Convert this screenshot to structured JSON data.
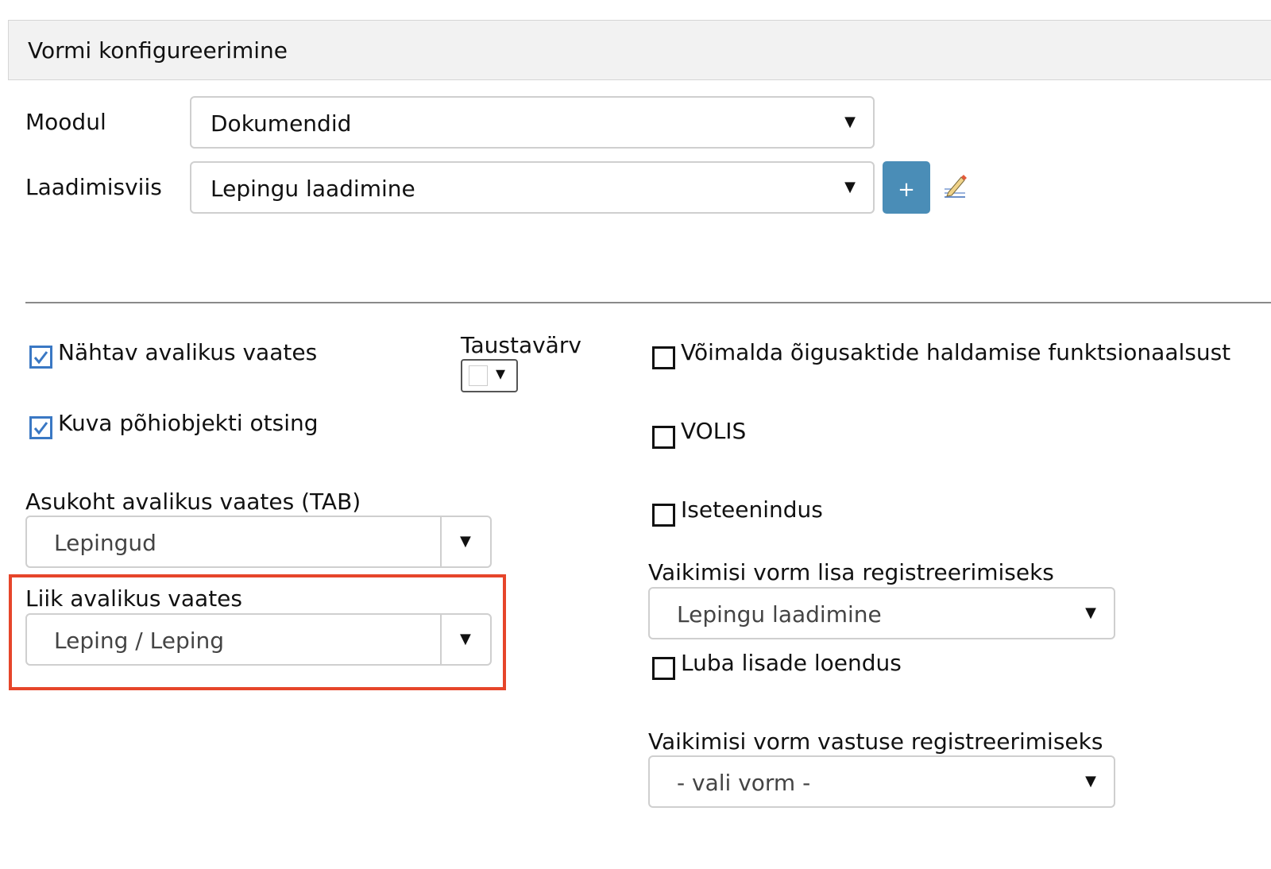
{
  "header": {
    "title": "Vormi konfigureerimine"
  },
  "moodul": {
    "label": "Moodul",
    "value": "Dokumendid"
  },
  "laadimisviis": {
    "label": "Laadimisviis",
    "value": "Lepingu laadimine",
    "add_label": "+"
  },
  "checkboxes_left": [
    {
      "label": "Nähtav avalikus vaates",
      "checked": true
    },
    {
      "label": "Kuva põhiobjekti otsing",
      "checked": true
    }
  ],
  "taustavarv": {
    "label": "Taustavärv",
    "caret": "▾"
  },
  "asukoht": {
    "label": "Asukoht avalikus vaates (TAB)",
    "value": "Lepingud"
  },
  "liik": {
    "label": "Liik avalikus vaates",
    "value": "Leping / Leping"
  },
  "checkboxes_right": [
    {
      "label": "Võimalda õigusaktide haldamise funktsionaalsust",
      "checked": false
    },
    {
      "label": "VOLIS",
      "checked": false
    },
    {
      "label": "Iseteenindus",
      "checked": false
    }
  ],
  "vaikimisi_lisa": {
    "label": "Vaikimisi vorm lisa registreerimiseks",
    "value": "Lepingu laadimine"
  },
  "luba_lisade": {
    "label": "Luba lisade loendus",
    "checked": false
  },
  "vaikimisi_vastuse": {
    "label": "Vaikimisi vorm vastuse registreerimiseks",
    "value": "- vali vorm -"
  },
  "caret": "▼",
  "colors": {
    "accent": "#4a8db7",
    "highlight": "#e6452a",
    "check": "#3a78c4"
  }
}
